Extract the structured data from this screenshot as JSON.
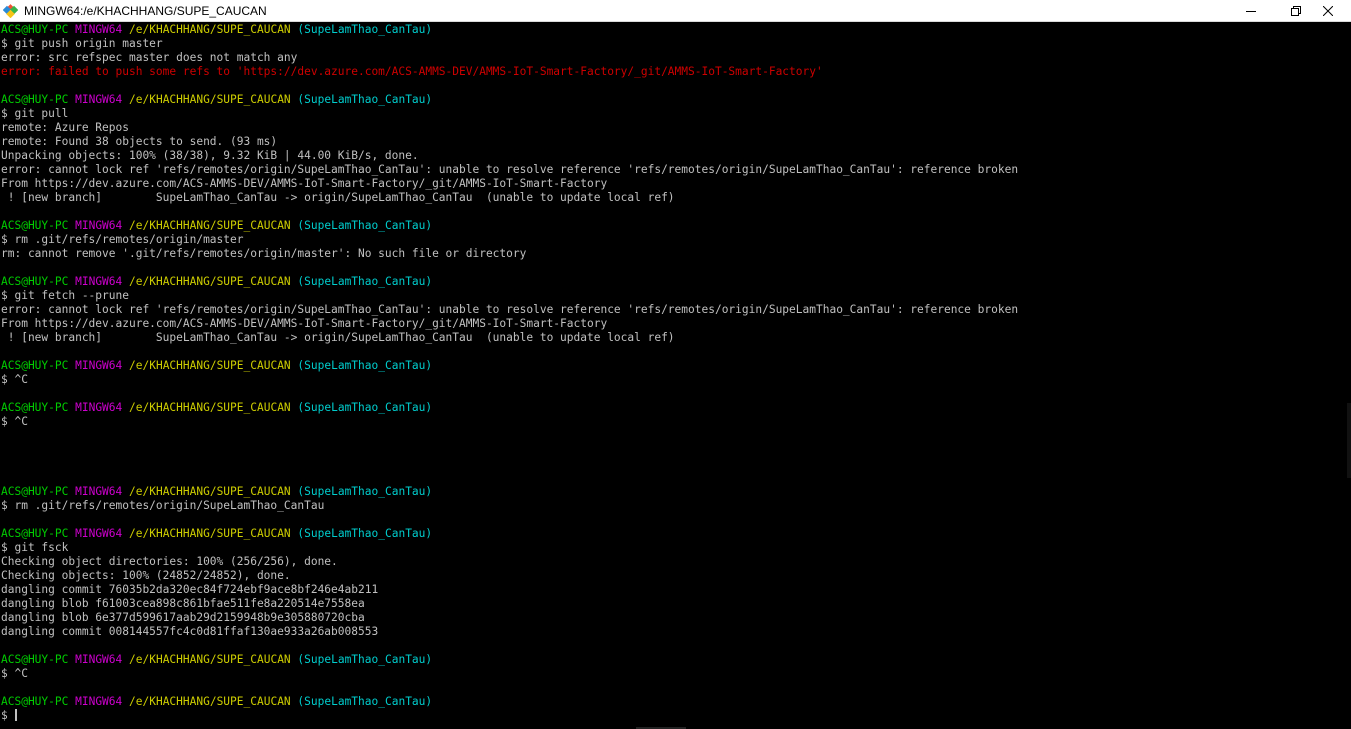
{
  "window": {
    "title": "MINGW64:/e/KHACHHANG/SUPE_CAUCAN",
    "controls": {
      "minimize_icon": "minimize-icon",
      "maximize_icon": "restore-icon",
      "close_icon": "close-icon"
    }
  },
  "colors": {
    "user_host": "#00cd00",
    "shell": "#cd00cd",
    "path": "#cdcd00",
    "branch": "#00cdcd",
    "error": "#cd0000",
    "text": "#c0c0c0",
    "background": "#000000"
  },
  "terminal": {
    "lines": [
      {
        "type": "prompt",
        "user": "ACS@HUY-PC",
        "shell": "MINGW64",
        "path": "/e/KHACHHANG/SUPE_CAUCAN",
        "branch": "(SupeLamThao_CanTau)"
      },
      {
        "type": "text",
        "text": "$ git push origin master"
      },
      {
        "type": "text",
        "text": "error: src refspec master does not match any"
      },
      {
        "type": "error",
        "text": "error: failed to push some refs to 'https://dev.azure.com/ACS-AMMS-DEV/AMMS-IoT-Smart-Factory/_git/AMMS-IoT-Smart-Factory'"
      },
      {
        "type": "text",
        "text": ""
      },
      {
        "type": "prompt",
        "user": "ACS@HUY-PC",
        "shell": "MINGW64",
        "path": "/e/KHACHHANG/SUPE_CAUCAN",
        "branch": "(SupeLamThao_CanTau)"
      },
      {
        "type": "text",
        "text": "$ git pull"
      },
      {
        "type": "text",
        "text": "remote: Azure Repos"
      },
      {
        "type": "text",
        "text": "remote: Found 38 objects to send. (93 ms)"
      },
      {
        "type": "text",
        "text": "Unpacking objects: 100% (38/38), 9.32 KiB | 44.00 KiB/s, done."
      },
      {
        "type": "text",
        "text": "error: cannot lock ref 'refs/remotes/origin/SupeLamThao_CanTau': unable to resolve reference 'refs/remotes/origin/SupeLamThao_CanTau': reference broken"
      },
      {
        "type": "text",
        "text": "From https://dev.azure.com/ACS-AMMS-DEV/AMMS-IoT-Smart-Factory/_git/AMMS-IoT-Smart-Factory"
      },
      {
        "type": "text",
        "text": " ! [new branch]        SupeLamThao_CanTau -> origin/SupeLamThao_CanTau  (unable to update local ref)"
      },
      {
        "type": "text",
        "text": ""
      },
      {
        "type": "prompt",
        "user": "ACS@HUY-PC",
        "shell": "MINGW64",
        "path": "/e/KHACHHANG/SUPE_CAUCAN",
        "branch": "(SupeLamThao_CanTau)"
      },
      {
        "type": "text",
        "text": "$ rm .git/refs/remotes/origin/master"
      },
      {
        "type": "text",
        "text": "rm: cannot remove '.git/refs/remotes/origin/master': No such file or directory"
      },
      {
        "type": "text",
        "text": ""
      },
      {
        "type": "prompt",
        "user": "ACS@HUY-PC",
        "shell": "MINGW64",
        "path": "/e/KHACHHANG/SUPE_CAUCAN",
        "branch": "(SupeLamThao_CanTau)"
      },
      {
        "type": "text",
        "text": "$ git fetch --prune"
      },
      {
        "type": "text",
        "text": "error: cannot lock ref 'refs/remotes/origin/SupeLamThao_CanTau': unable to resolve reference 'refs/remotes/origin/SupeLamThao_CanTau': reference broken"
      },
      {
        "type": "text",
        "text": "From https://dev.azure.com/ACS-AMMS-DEV/AMMS-IoT-Smart-Factory/_git/AMMS-IoT-Smart-Factory"
      },
      {
        "type": "text",
        "text": " ! [new branch]        SupeLamThao_CanTau -> origin/SupeLamThao_CanTau  (unable to update local ref)"
      },
      {
        "type": "text",
        "text": ""
      },
      {
        "type": "prompt",
        "user": "ACS@HUY-PC",
        "shell": "MINGW64",
        "path": "/e/KHACHHANG/SUPE_CAUCAN",
        "branch": "(SupeLamThao_CanTau)"
      },
      {
        "type": "text",
        "text": "$ ^C"
      },
      {
        "type": "text",
        "text": ""
      },
      {
        "type": "prompt",
        "user": "ACS@HUY-PC",
        "shell": "MINGW64",
        "path": "/e/KHACHHANG/SUPE_CAUCAN",
        "branch": "(SupeLamThao_CanTau)"
      },
      {
        "type": "text",
        "text": "$ ^C"
      },
      {
        "type": "text",
        "text": ""
      },
      {
        "type": "text",
        "text": ""
      },
      {
        "type": "text",
        "text": ""
      },
      {
        "type": "text",
        "text": ""
      },
      {
        "type": "prompt",
        "user": "ACS@HUY-PC",
        "shell": "MINGW64",
        "path": "/e/KHACHHANG/SUPE_CAUCAN",
        "branch": "(SupeLamThao_CanTau)"
      },
      {
        "type": "text",
        "text": "$ rm .git/refs/remotes/origin/SupeLamThao_CanTau"
      },
      {
        "type": "text",
        "text": ""
      },
      {
        "type": "prompt",
        "user": "ACS@HUY-PC",
        "shell": "MINGW64",
        "path": "/e/KHACHHANG/SUPE_CAUCAN",
        "branch": "(SupeLamThao_CanTau)"
      },
      {
        "type": "text",
        "text": "$ git fsck"
      },
      {
        "type": "text",
        "text": "Checking object directories: 100% (256/256), done."
      },
      {
        "type": "text",
        "text": "Checking objects: 100% (24852/24852), done."
      },
      {
        "type": "text",
        "text": "dangling commit 76035b2da320ec84f724ebf9ace8bf246e4ab211"
      },
      {
        "type": "text",
        "text": "dangling blob f61003cea898c861bfae511fe8a220514e7558ea"
      },
      {
        "type": "text",
        "text": "dangling blob 6e377d599617aab29d2159948b9e305880720cba"
      },
      {
        "type": "text",
        "text": "dangling commit 008144557fc4c0d81ffaf130ae933a26ab008553"
      },
      {
        "type": "text",
        "text": ""
      },
      {
        "type": "prompt",
        "user": "ACS@HUY-PC",
        "shell": "MINGW64",
        "path": "/e/KHACHHANG/SUPE_CAUCAN",
        "branch": "(SupeLamThao_CanTau)"
      },
      {
        "type": "text",
        "text": "$ ^C"
      },
      {
        "type": "text",
        "text": ""
      },
      {
        "type": "prompt",
        "user": "ACS@HUY-PC",
        "shell": "MINGW64",
        "path": "/e/KHACHHANG/SUPE_CAUCAN",
        "branch": "(SupeLamThao_CanTau)"
      },
      {
        "type": "input",
        "text": "$ "
      }
    ]
  }
}
